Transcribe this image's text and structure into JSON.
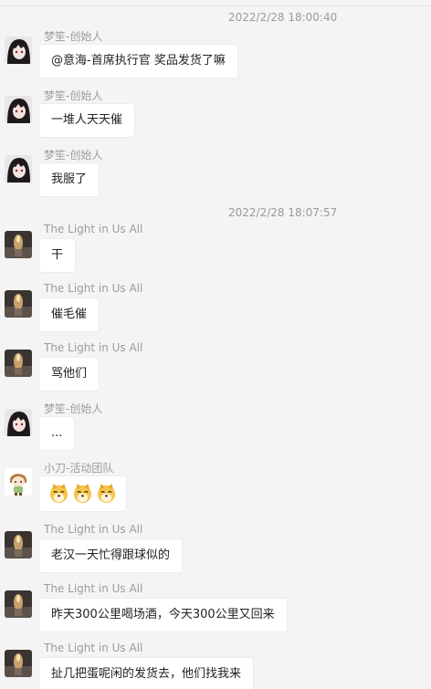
{
  "timestamps": [
    "2022/2/28 18:00:40",
    "2022/2/28 18:07:57"
  ],
  "messages": [
    {
      "sender": "梦笙-创始人",
      "text": "@意海-首席执行官 奖品发货了嘛",
      "avatar": "dark-hair-avatar-icon"
    },
    {
      "sender": "梦笙-创始人",
      "text": "一堆人天天催",
      "avatar": "dark-hair-avatar-icon"
    },
    {
      "sender": "梦笙-创始人",
      "text": "我服了",
      "avatar": "dark-hair-avatar-icon"
    },
    {
      "sender": "The Light in Us All",
      "text": "干",
      "avatar": "candle-photo-avatar-icon"
    },
    {
      "sender": "The Light in Us All",
      "text": "催毛催",
      "avatar": "candle-photo-avatar-icon"
    },
    {
      "sender": "The Light in Us All",
      "text": "骂他们",
      "avatar": "candle-photo-avatar-icon"
    },
    {
      "sender": "梦笙-创始人",
      "text": "...",
      "avatar": "dark-hair-avatar-icon"
    },
    {
      "sender": "小刀-活动团队",
      "text": "",
      "emoji": [
        "doge-emoji-icon",
        "doge-emoji-icon",
        "doge-emoji-icon"
      ],
      "avatar": "chibi-character-avatar-icon"
    },
    {
      "sender": "The Light in Us All",
      "text": "老汉一天忙得跟球似的",
      "avatar": "candle-photo-avatar-icon"
    },
    {
      "sender": "The Light in Us All",
      "text": "昨天300公里喝场酒，今天300公里又回来",
      "avatar": "candle-photo-avatar-icon"
    },
    {
      "sender": "The Light in Us All",
      "text": "扯几把蛋呢闲的发货去，他们找我来",
      "avatar": "candle-photo-avatar-icon"
    }
  ],
  "colors": {
    "background": "#f4f4f4",
    "bubble": "#ffffff",
    "sender": "#9c9c9c",
    "timestamp": "#9a9a9a"
  }
}
